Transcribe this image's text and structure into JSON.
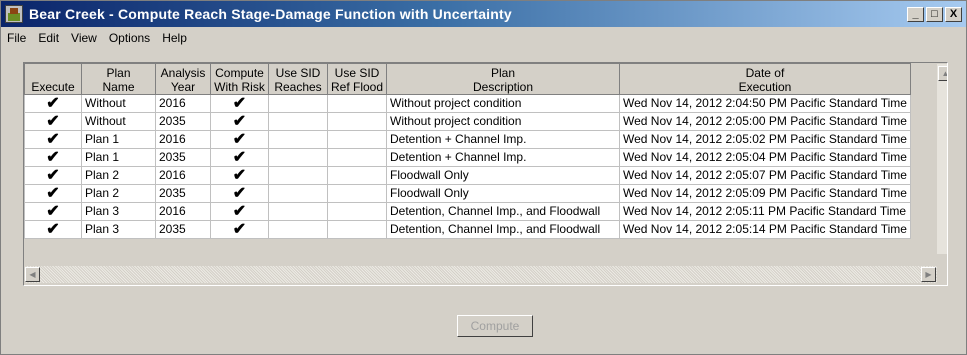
{
  "window": {
    "title": "Bear Creek - Compute Reach Stage-Damage Function with Uncertainty",
    "controls": [
      "_",
      "□",
      "X"
    ]
  },
  "menu": [
    {
      "label": "File"
    },
    {
      "label": "Edit"
    },
    {
      "label": "View"
    },
    {
      "label": "Options"
    },
    {
      "label": "Help"
    }
  ],
  "grid": {
    "headers": [
      {
        "line1": "",
        "line2": "Execute"
      },
      {
        "line1": "Plan",
        "line2": "Name"
      },
      {
        "line1": "Analysis",
        "line2": "Year"
      },
      {
        "line1": "Compute",
        "line2": "With Risk"
      },
      {
        "line1": "Use SID",
        "line2": "Reaches"
      },
      {
        "line1": "Use SID",
        "line2": "Ref Flood"
      },
      {
        "line1": "Plan",
        "line2": "Description"
      },
      {
        "line1": "Date of",
        "line2": "Execution"
      }
    ],
    "check_glyph": "✔",
    "rows": [
      {
        "execute": true,
        "plan": "Without",
        "year": "2016",
        "risk": true,
        "sid_reaches": "",
        "sid_ref": "",
        "desc": "Without project condition",
        "date": "Wed Nov 14, 2012 2:04:50 PM Pacific Standard Time"
      },
      {
        "execute": true,
        "plan": "Without",
        "year": "2035",
        "risk": true,
        "sid_reaches": "",
        "sid_ref": "",
        "desc": "Without project condition",
        "date": "Wed Nov 14, 2012 2:05:00 PM Pacific Standard Time"
      },
      {
        "execute": true,
        "plan": "Plan 1",
        "year": "2016",
        "risk": true,
        "sid_reaches": "",
        "sid_ref": "",
        "desc": "Detention + Channel Imp.",
        "date": "Wed Nov 14, 2012 2:05:02 PM Pacific Standard Time"
      },
      {
        "execute": true,
        "plan": "Plan 1",
        "year": "2035",
        "risk": true,
        "sid_reaches": "",
        "sid_ref": "",
        "desc": "Detention + Channel Imp.",
        "date": "Wed Nov 14, 2012 2:05:04 PM Pacific Standard Time"
      },
      {
        "execute": true,
        "plan": "Plan 2",
        "year": "2016",
        "risk": true,
        "sid_reaches": "",
        "sid_ref": "",
        "desc": "Floodwall Only",
        "date": "Wed Nov 14, 2012 2:05:07 PM Pacific Standard Time"
      },
      {
        "execute": true,
        "plan": "Plan 2",
        "year": "2035",
        "risk": true,
        "sid_reaches": "",
        "sid_ref": "",
        "desc": "Floodwall Only",
        "date": "Wed Nov 14, 2012 2:05:09 PM Pacific Standard Time"
      },
      {
        "execute": true,
        "plan": "Plan 3",
        "year": "2016",
        "risk": true,
        "sid_reaches": "",
        "sid_ref": "",
        "desc": "Detention, Channel Imp., and Floodwall",
        "date": "Wed Nov 14, 2012 2:05:11 PM Pacific Standard Time"
      },
      {
        "execute": true,
        "plan": "Plan 3",
        "year": "2035",
        "risk": true,
        "sid_reaches": "",
        "sid_ref": "",
        "desc": "Detention, Channel Imp., and Floodwall",
        "date": "Wed Nov 14, 2012 2:05:14 PM Pacific Standard Time"
      }
    ]
  },
  "buttons": {
    "compute": "Compute"
  }
}
